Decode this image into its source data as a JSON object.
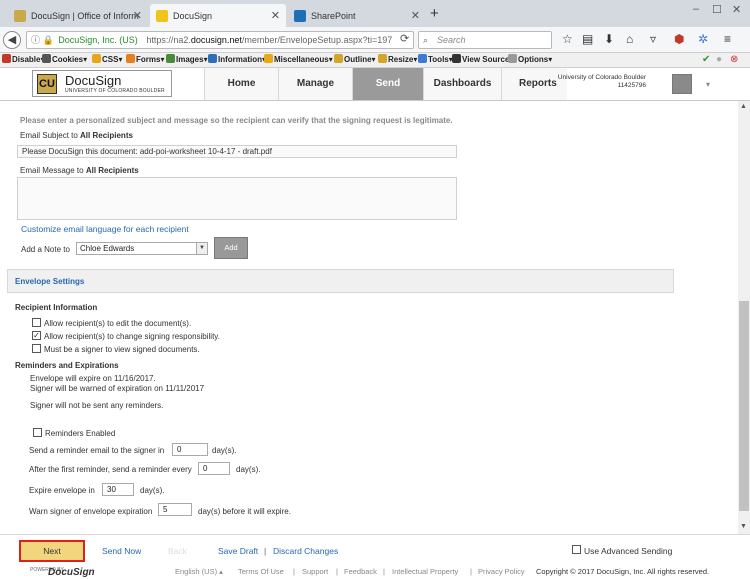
{
  "browser": {
    "tabs": [
      {
        "title": "DocuSign | Office of Inform",
        "active": false
      },
      {
        "title": "DocuSign",
        "active": true
      },
      {
        "title": "SharePoint",
        "active": false
      }
    ],
    "new_tab": "+",
    "window_controls": [
      "–",
      "☐",
      "✕"
    ],
    "url_site": "DocuSign, Inc. (US)",
    "url_prefix": "https://na2.",
    "url_host": "docusign.net",
    "url_path": "/member/EnvelopeSetup.aspx?ti=197",
    "search_placeholder": "Search",
    "devbar": [
      "Disable▾",
      "Cookies▾",
      "CSS▾",
      "Forms▾",
      "Images▾",
      "Information▾",
      "Miscellaneous▾",
      "Outline▾",
      "Resize▾",
      "Tools▾",
      "View Source▾",
      "Options▾"
    ]
  },
  "header": {
    "logo_name": "DocuSign",
    "logo_sub": "UNIVERSITY OF COLORADO BOULDER",
    "logo_mark": "CU",
    "nav": [
      "Home",
      "Manage",
      "Send",
      "Dashboards",
      "Reports"
    ],
    "active_nav": "Send",
    "account_name": "University of Colorado Boulder",
    "account_id": "11425796"
  },
  "form": {
    "intro": "Please enter a personalized subject and message so the recipient can verify that the signing request is legitimate.",
    "subject_label_prefix": "Email Subject to ",
    "subject_label_strong": "All Recipients",
    "subject_value": "Please DocuSign this document: add-poi-worksheet 10-4-17 - draft.pdf",
    "message_label_prefix": "Email Message to ",
    "message_label_strong": "All Recipients",
    "message_value": "",
    "customize_link": "Customize email language for each recipient",
    "note_label": "Add a Note to",
    "note_recipient": "Chloe Edwards",
    "add_button": "Add"
  },
  "envelope_settings": {
    "title": "Envelope Settings",
    "recipient_info_head": "Recipient Information",
    "options": [
      {
        "label": "Allow recipient(s) to edit the document(s).",
        "checked": false
      },
      {
        "label": "Allow recipient(s) to change signing responsibility.",
        "checked": true
      },
      {
        "label": "Must be a signer to view signed documents.",
        "checked": false
      }
    ],
    "reminders_head": "Reminders and Expirations",
    "expire_line": "Envelope will expire on 11/16/2017.",
    "warn_line": "Signer will be warned of expiration on 11/11/2017",
    "no_reminders": "Signer will not be sent any reminders.",
    "reminders_enabled_label": "Reminders Enabled",
    "reminders_enabled": false,
    "send_reminder_prefix": "Send a reminder email to the signer in",
    "send_reminder_value": "0",
    "send_reminder_suffix": "day(s).",
    "after_first_prefix": "After the first reminder, send a reminder every",
    "after_first_value": "0",
    "after_first_suffix": "day(s).",
    "expire_prefix": "Expire envelope in",
    "expire_value": "30",
    "expire_suffix": "day(s).",
    "warn_prefix": "Warn signer of envelope expiration",
    "warn_value": "5",
    "warn_suffix": "day(s) before it will expire."
  },
  "footer": {
    "next": "Next",
    "send_now": "Send Now",
    "back": "Back",
    "save_draft": "Save Draft",
    "sep": "|",
    "discard": "Discard Changes",
    "advanced_sending": "Use Advanced Sending",
    "powered_by": "POWERED BY",
    "powered_logo": "DocuSign",
    "language": "English (US) ▴",
    "terms": "Terms Of Use",
    "support": "Support",
    "feedback": "Feedback",
    "ip": "Intellectual Property",
    "privacy": "Privacy Policy",
    "copyright": "Copyright © 2017 DocuSign, Inc. All rights reserved."
  },
  "colors": {
    "link": "#2767b0",
    "next_button": "#f3d57e",
    "next_outline": "#e0201a",
    "active_nav": "#9a9a9a"
  }
}
